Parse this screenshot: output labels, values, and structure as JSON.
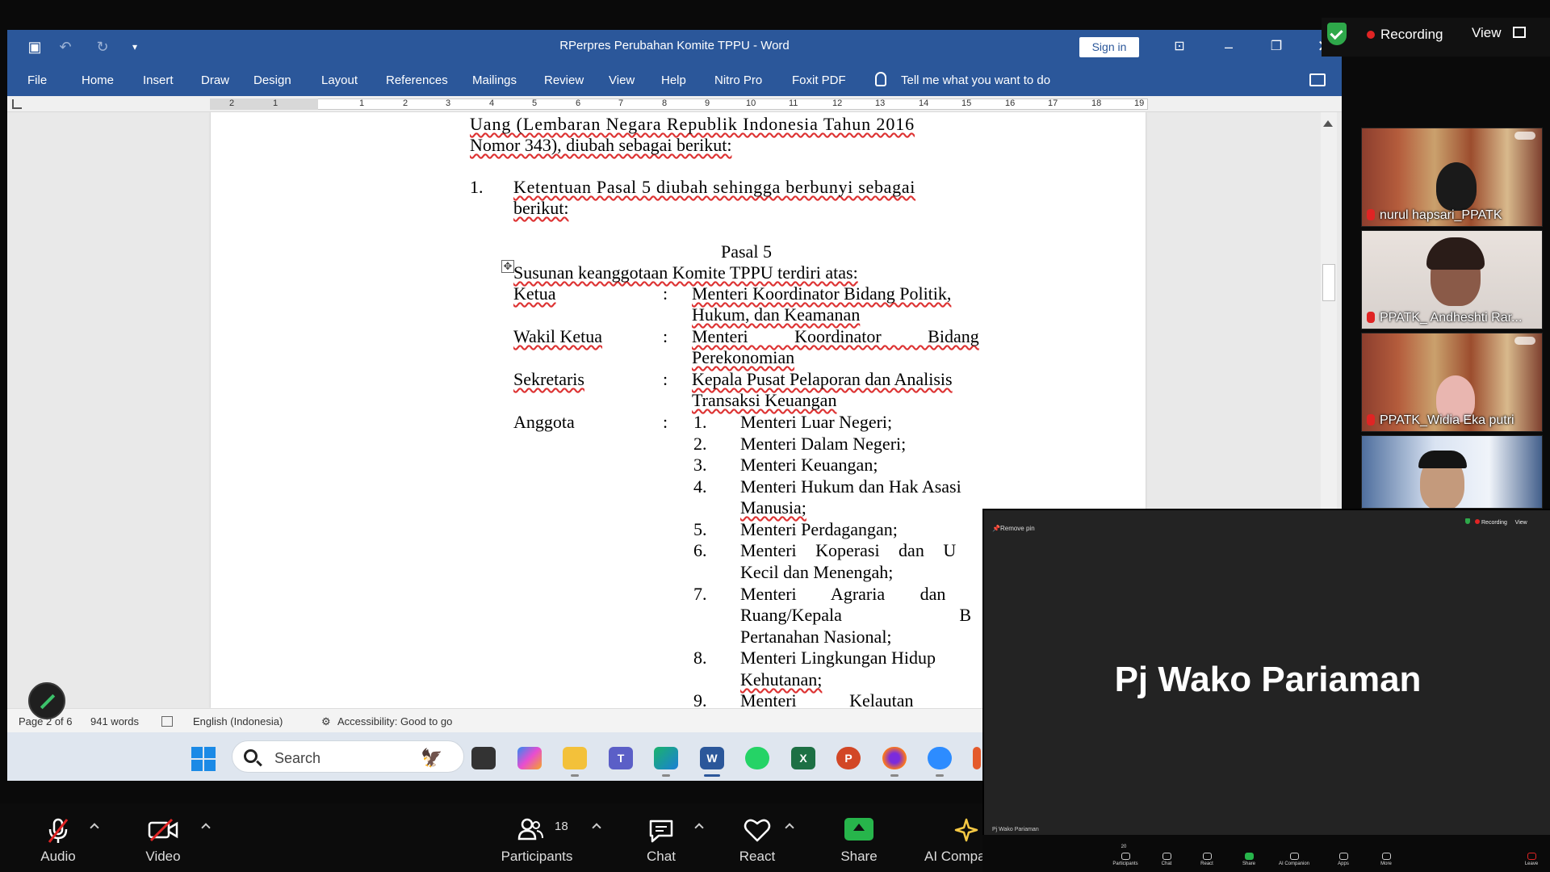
{
  "word": {
    "title": "RPerpres Perubahan Komite TPPU  -  Word",
    "sign_in": "Sign in",
    "tabs": [
      "File",
      "Home",
      "Insert",
      "Draw",
      "Design",
      "Layout",
      "References",
      "Mailings",
      "Review",
      "View",
      "Help",
      "Nitro Pro",
      "Foxit PDF"
    ],
    "tell_me": "Tell me what you want to do",
    "ruler": [
      "2",
      "1",
      "1",
      "2",
      "3",
      "4",
      "5",
      "6",
      "7",
      "8",
      "9",
      "10",
      "11",
      "12",
      "13",
      "14",
      "15",
      "16",
      "17",
      "18",
      "19"
    ],
    "status": {
      "page": "Page 2 of 6",
      "words": "941 words",
      "language": "English (Indonesia)",
      "accessibility": "Accessibility: Good to go"
    }
  },
  "document": {
    "intro1": "Uang (Lembaran Negara Republik Indonesia Tahun 2016",
    "intro2": "Nomor 343), diubah sebagai berikut:",
    "item_num": "1.",
    "item_line1": "Ketentuan Pasal 5 diubah sehingga berbunyi sebagai",
    "item_line2": "berikut:",
    "pasal": "Pasal 5",
    "susunan": "Susunan keanggotaan Komite TPPU terdiri atas:",
    "ketua_label": "Ketua",
    "ketua_v1": "Menteri Koordinator Bidang Politik,",
    "ketua_v2": "Hukum, dan Keamanan",
    "wakil_label": "Wakil Ketua",
    "wakil_v1": "Menteri Koordinator Bidang",
    "wakil_v2": "Perekonomian",
    "sekretaris_label": "Sekretaris",
    "sekretaris_v1": "Kepala Pusat Pelaporan dan Analisis",
    "sekretaris_v2": "Transaksi Keuangan",
    "anggota_label": "Anggota",
    "colon": ":",
    "members": [
      {
        "num": "1.",
        "lines": [
          "Menteri Luar Negeri;"
        ]
      },
      {
        "num": "2.",
        "lines": [
          "Menteri Dalam Negeri;"
        ]
      },
      {
        "num": "3.",
        "lines": [
          "Menteri Keuangan;"
        ]
      },
      {
        "num": "4.",
        "lines": [
          "Menteri Hukum dan Hak Asasi",
          "Manusia;"
        ]
      },
      {
        "num": "5.",
        "lines": [
          "Menteri Perdagangan;"
        ]
      },
      {
        "num": "6.",
        "lines": [
          "Menteri Koperasi dan U",
          "Kecil dan Menengah;"
        ]
      },
      {
        "num": "7.",
        "lines": [
          "Menteri Agraria dan",
          "Ruang/Kepala B",
          "Pertanahan Nasional;"
        ]
      },
      {
        "num": "8.",
        "lines": [
          "Menteri Lingkungan Hidup",
          "Kehutanan;"
        ]
      },
      {
        "num": "9.",
        "lines": [
          "Menteri Kelautan"
        ]
      }
    ]
  },
  "taskbar": {
    "search": "Search"
  },
  "zoom": {
    "recording": "Recording",
    "view": "View",
    "participants": [
      {
        "name": "nurul hapsari_PPATK"
      },
      {
        "name": "PPATK_ Andheshti Rar..."
      },
      {
        "name": "PPATK_Widia Eka putri"
      },
      {
        "name": ""
      }
    ],
    "speaker": {
      "name": "Pj Wako Pariaman",
      "remove_pin": "Remove pin",
      "recording": "Recording",
      "view": "View",
      "label": "Pj Wako Pariaman",
      "mini_toolbar": [
        "Participants",
        "Chat",
        "React",
        "Share",
        "AI Companion",
        "Apps",
        "More",
        "Leave"
      ],
      "mini_count": "20"
    },
    "toolbar": {
      "audio": "Audio",
      "video": "Video",
      "participants": "Participants",
      "participants_count": "18",
      "chat": "Chat",
      "react": "React",
      "share": "Share",
      "ai": "AI Compa"
    }
  },
  "colors": {
    "word_blue": "#2b579a",
    "zoom_green": "#27b54b",
    "record_red": "#e02424"
  }
}
